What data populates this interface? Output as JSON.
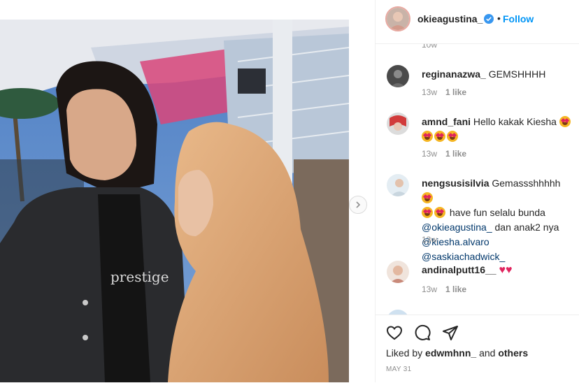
{
  "post": {
    "author": "okieagustina_",
    "follow_label": "Follow",
    "separator": "•",
    "shirt_text": "prestige"
  },
  "comments": {
    "cut_top_meta": "10w",
    "items": [
      {
        "user": "reginanazwa_",
        "text": "GEMSHHHH",
        "time": "13w",
        "likes": "1 like"
      },
      {
        "user": "amnd_fani",
        "text": "Hello kakak Kiesha",
        "time": "13w",
        "likes": "1 like"
      },
      {
        "user": "nengsusisilvia",
        "text": "Gemassshhhhh",
        "text2": "have fun selalu bunda",
        "mention1": "@okieagustina_",
        "text3": "dan anak2 nya",
        "mention2": "@kiesha.alvaro",
        "mention3": "@saskiachadwick_",
        "time": "13w"
      },
      {
        "user": "andinalputt16__",
        "text": "♥♥",
        "time": "13w",
        "likes": "1 like"
      }
    ]
  },
  "actions": {
    "liked_prefix": "Liked by",
    "liked_user": "edwmhnn_",
    "liked_and": "and",
    "liked_others": "others",
    "date": "MAY 31"
  },
  "colors": {
    "accent": "#0095f6",
    "text": "#262626",
    "muted": "#8e8e8e",
    "heart": "#e0245e"
  }
}
